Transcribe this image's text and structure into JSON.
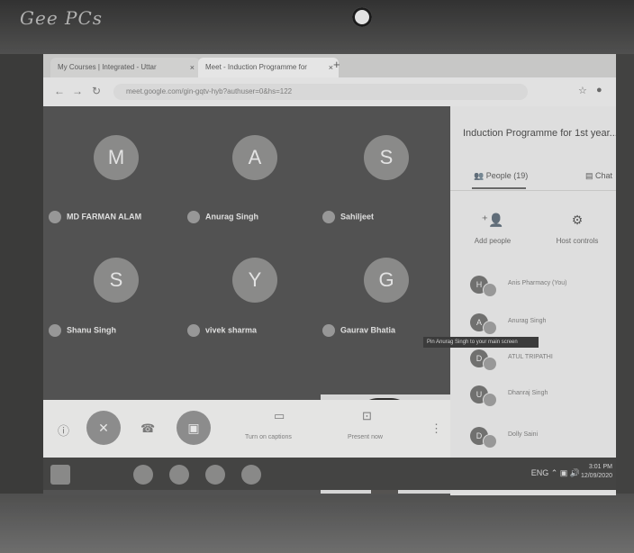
{
  "device": {
    "brand": "Gee PCs"
  },
  "browser": {
    "tabs": [
      {
        "label": "My Courses | Integrated - Uttar",
        "active": false
      },
      {
        "label": "Meet - Induction Programme for",
        "active": true
      }
    ],
    "url": "meet.google.com/gin-gqtv-hyb?authuser=0&hs=122"
  },
  "meet": {
    "participants_grid": [
      {
        "initial": "M",
        "name": "MD FARMAN ALAM"
      },
      {
        "initial": "A",
        "name": "Anurag Singh"
      },
      {
        "initial": "S",
        "name": "Sahiljeet"
      },
      {
        "initial": "S",
        "name": "Shanu Singh"
      },
      {
        "initial": "Y",
        "name": "vivek sharma"
      },
      {
        "initial": "G",
        "name": "Gaurav Bhatia"
      }
    ],
    "panel": {
      "title": "Induction Programme for 1st year...",
      "tab_people": "People (19)",
      "tab_chat": "Chat",
      "action_add": "Add people",
      "action_host": "Host controls",
      "people": [
        {
          "initial": "H",
          "name": "Anis Pharmacy (You)"
        },
        {
          "initial": "A",
          "name": "Anurag Singh"
        },
        {
          "initial": "D",
          "name": "ATUL TRIPATHI"
        },
        {
          "initial": "U",
          "name": "Dhanraj Singh"
        },
        {
          "initial": "D",
          "name": "Dolly Saini"
        }
      ]
    },
    "tooltip": "Pin Anurag Singh to your main screen",
    "callbar": {
      "present_label": "Turn on captions",
      "present_now": "Present now"
    }
  },
  "taskbar": {
    "tray": "ENG ⌃ ▣ 🔊",
    "time": "3:01 PM",
    "date": "12/09/2020"
  }
}
